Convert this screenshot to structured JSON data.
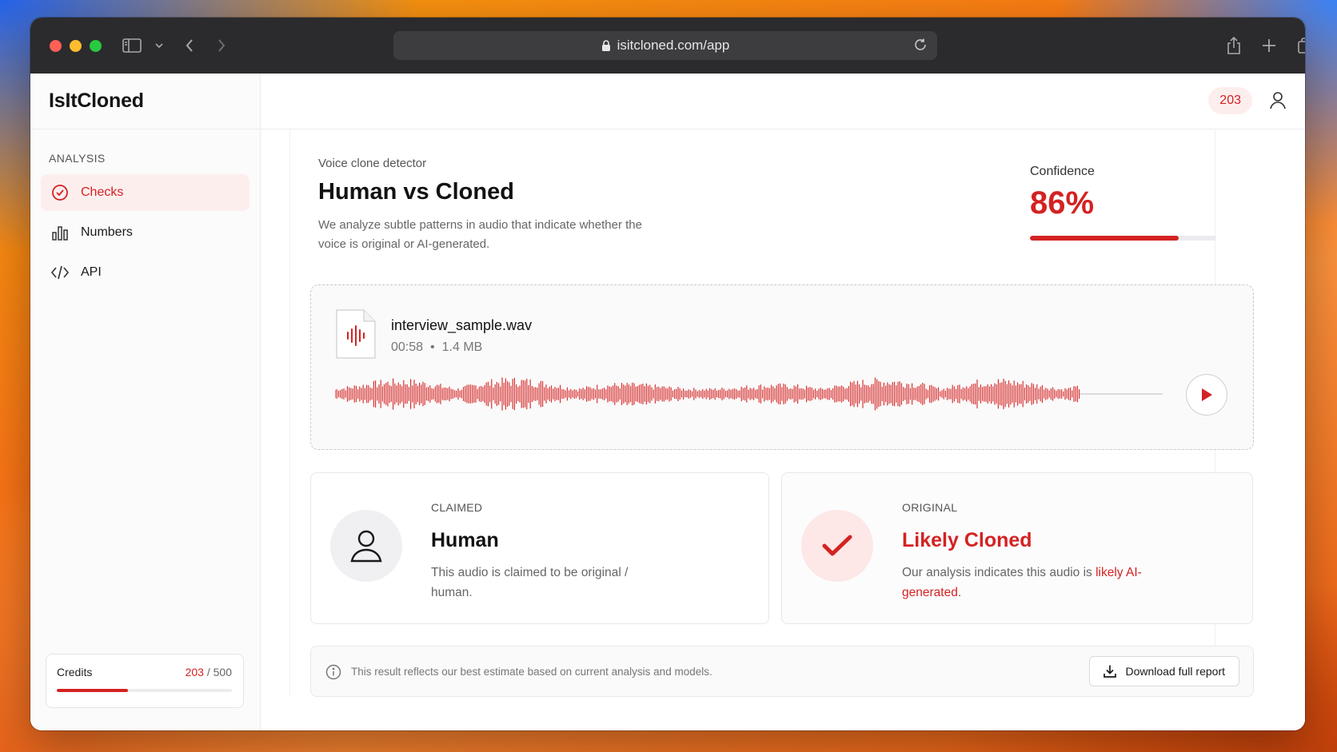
{
  "browser": {
    "url": "isitcloned.com/app"
  },
  "sidebar": {
    "brand": "IsItCloned",
    "section_label": "ANALYSIS",
    "items": [
      {
        "label": "Checks",
        "icon": "check-circle-icon",
        "active": true
      },
      {
        "label": "Numbers",
        "icon": "bar-chart-icon",
        "active": false
      },
      {
        "label": "API",
        "icon": "code-icon",
        "active": false
      }
    ],
    "credits": {
      "label": "Credits",
      "used": "203",
      "separator": "/",
      "total": "500",
      "fraction": 0.406
    }
  },
  "topbar": {
    "badge": "203"
  },
  "detector": {
    "eyebrow": "Voice clone detector",
    "title": "Human vs Cloned",
    "description": "We analyze subtle patterns in audio that indicate whether the voice is original or AI-generated.",
    "confidence_label": "Confidence",
    "confidence_value": "86%",
    "confidence_fraction": 0.8
  },
  "audio": {
    "file_name": "interview_sample.wav",
    "duration": "00:58",
    "size": "1.4 MB",
    "played_fraction": 0.9
  },
  "results": {
    "claimed": {
      "eyebrow": "CLAIMED",
      "title": "Human",
      "description": "This audio is claimed to be original / human."
    },
    "original": {
      "eyebrow": "ORIGINAL",
      "title": "Likely Cloned",
      "description": "Our analysis indicates this audio is",
      "highlight": "likely AI-generated",
      "suffix": "."
    }
  },
  "footer": {
    "note": "This result reflects our best estimate based on current analysis and models.",
    "download_label": "Download full report"
  },
  "colors": {
    "accent": "#d42222",
    "accent_soft": "#fdeeee"
  }
}
